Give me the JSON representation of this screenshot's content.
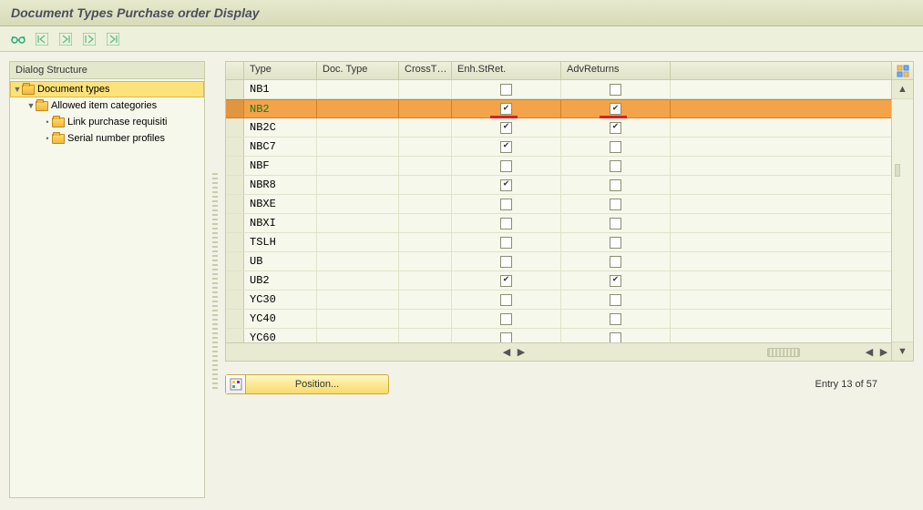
{
  "title": "Document Types Purchase order Display",
  "toolbar_icons": [
    "glasses-icon",
    "table-nav-icon",
    "table-next-icon",
    "table-end-icon",
    "table-export-icon"
  ],
  "tree": {
    "header": "Dialog Structure",
    "nodes": [
      {
        "label": "Document types",
        "level": 0,
        "expand": "▼",
        "selected": true
      },
      {
        "label": "Allowed item categories",
        "level": 1,
        "expand": "▼",
        "selected": false
      },
      {
        "label": "Link purchase requisiti",
        "level": 2,
        "expand": "•",
        "selected": false
      },
      {
        "label": "Serial number profiles",
        "level": 2,
        "expand": "•",
        "selected": false
      }
    ]
  },
  "grid": {
    "columns": [
      "Type",
      "Doc. Type",
      "CrossT…",
      "Enh.StRet.",
      "AdvReturns"
    ],
    "rows": [
      {
        "type": "NB1",
        "enh": false,
        "adv": false,
        "sel": false
      },
      {
        "type": "NB2",
        "enh": true,
        "adv": true,
        "sel": true,
        "mark": true
      },
      {
        "type": "NB2C",
        "enh": true,
        "adv": true,
        "sel": false
      },
      {
        "type": "NBC7",
        "enh": true,
        "adv": false,
        "sel": false
      },
      {
        "type": "NBF",
        "enh": false,
        "adv": false,
        "sel": false
      },
      {
        "type": "NBR8",
        "enh": true,
        "adv": false,
        "sel": false
      },
      {
        "type": "NBXE",
        "enh": false,
        "adv": false,
        "sel": false
      },
      {
        "type": "NBXI",
        "enh": false,
        "adv": false,
        "sel": false
      },
      {
        "type": "TSLH",
        "enh": false,
        "adv": false,
        "sel": false
      },
      {
        "type": "UB",
        "enh": false,
        "adv": false,
        "sel": false
      },
      {
        "type": "UB2",
        "enh": true,
        "adv": true,
        "sel": false
      },
      {
        "type": "YC30",
        "enh": false,
        "adv": false,
        "sel": false
      },
      {
        "type": "YC40",
        "enh": false,
        "adv": false,
        "sel": false
      },
      {
        "type": "YC60",
        "enh": false,
        "adv": false,
        "sel": false
      }
    ]
  },
  "position_button": "Position...",
  "entry_text": "Entry 13 of 57"
}
